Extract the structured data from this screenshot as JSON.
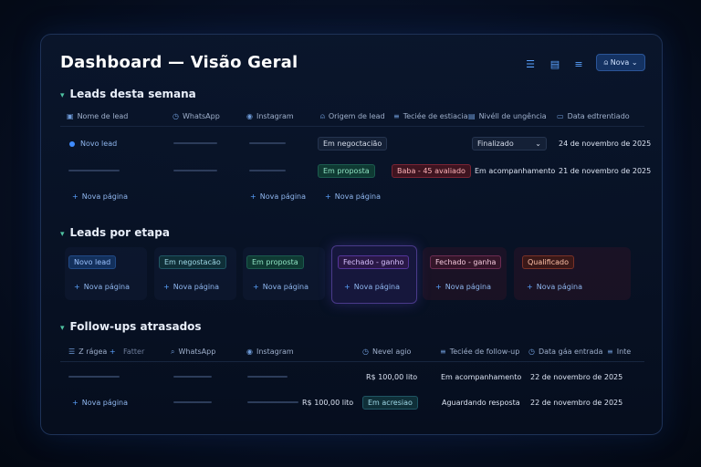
{
  "header": {
    "title": "Dashboard — Visão Geral",
    "new_button": "Nova"
  },
  "icons": {
    "filter": "filter-icon",
    "layout": "layout-icon",
    "list": "list-icon",
    "user": "user-icon"
  },
  "section1": {
    "title": "Leads desta semana",
    "columns": [
      "Nome de lead",
      "WhatsApp",
      "Instagram",
      "Origem de lead",
      "Teciée de estiacia",
      "Nivéll de ungência",
      "Data edtrentiado"
    ],
    "row1": {
      "name": "Novo lead",
      "origem": "Em negoctacião",
      "nivel": "Finalizado",
      "data": "24 de novembro de 2025"
    },
    "row2": {
      "origem": "Em proposta",
      "tecie": "Baba - 45 avaliado",
      "nivel": "Em acompanhamento",
      "data": "21 de novembro de 2025"
    },
    "new_page": "Nova página"
  },
  "section2": {
    "title": "Leads por etapa",
    "stages": [
      "Novo lead",
      "Em negostacão",
      "Em proposta",
      "Fechado - ganho",
      "Fechado - ganha",
      "Qualificado"
    ],
    "new_page": "Nova página"
  },
  "section3": {
    "title": "Follow-ups atrasados",
    "columns": [
      "Z rágea",
      "Fatter",
      "WhatsApp",
      "Instagram",
      "Nevel agio",
      "Teciée de follow-up",
      "Data gáa entrada",
      "Inte"
    ],
    "row1": {
      "nevel": "R$ 100,00 lito",
      "tecie": "Em acompanhamento",
      "data": "22 de novembro de 2025"
    },
    "row2": {
      "instagram_value": "R$ 100,00 lito",
      "nevel": "Em acresiao",
      "tecie": "Aguardando resposta",
      "data": "22 de novembro de 2025"
    },
    "new_page": "Nova página"
  }
}
